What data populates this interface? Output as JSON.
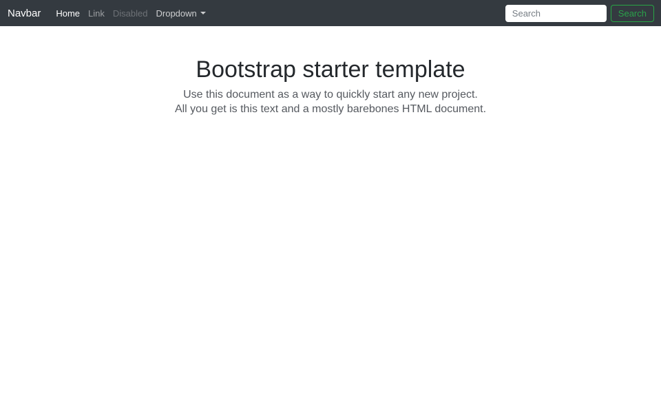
{
  "navbar": {
    "brand": "Navbar",
    "items": [
      {
        "label": "Home",
        "state": "active"
      },
      {
        "label": "Link",
        "state": "normal"
      },
      {
        "label": "Disabled",
        "state": "disabled"
      },
      {
        "label": "Dropdown",
        "state": "dropdown"
      }
    ],
    "search": {
      "placeholder": "Search",
      "button_label": "Search"
    }
  },
  "main": {
    "title": "Bootstrap starter template",
    "lead_line1": "Use this document as a way to quickly start any new project.",
    "lead_line2": "All you get is this text and a mostly barebones HTML document."
  },
  "colors": {
    "navbar_bg": "#343a40",
    "success_green": "#28a745",
    "title_text": "#24282c",
    "lead_text": "#55595f"
  }
}
